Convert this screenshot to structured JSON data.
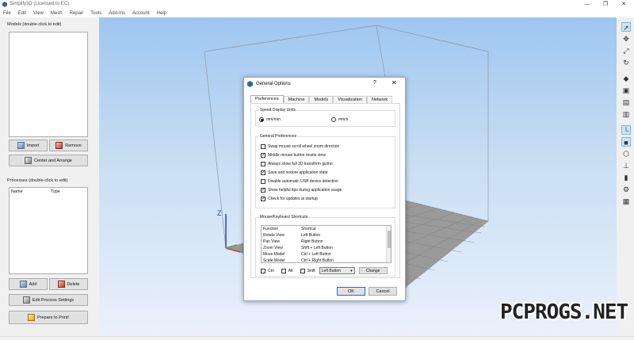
{
  "window": {
    "title": "Simplify3D (Licensed to EC)",
    "minimize": "—",
    "maximize": "❐",
    "close": "✕"
  },
  "menu": [
    "File",
    "Edit",
    "View",
    "Mesh",
    "Repair",
    "Tools",
    "Add-Ins",
    "Account",
    "Help"
  ],
  "models_panel": {
    "label": "Models (double-click to edit)",
    "import_label": "Import",
    "remove_label": "Remove",
    "center_label": "Center and Arrange"
  },
  "processes_panel": {
    "label": "Processes (double-click to edit)",
    "col_name": "Name",
    "col_type": "Type",
    "add_label": "Add",
    "delete_label": "Delete",
    "edit_label": "Edit Process Settings",
    "prepare_label": "Prepare to Print!"
  },
  "dialog": {
    "title": "General Options",
    "help": "?",
    "close": "✕",
    "tabs": [
      "Preferences",
      "Machine",
      "Models",
      "Visualization",
      "Network"
    ],
    "speed_units": {
      "label": "Speed Display Units",
      "options": [
        "mm/min",
        "mm/s"
      ],
      "selected": "mm/min"
    },
    "general_prefs": {
      "label": "General Preferences",
      "items": [
        {
          "label": "Swap mouse scroll wheel zoom direction",
          "checked": false
        },
        {
          "label": "Middle mouse button resets view",
          "checked": true
        },
        {
          "label": "Always show full 3D transform gizmo",
          "checked": false
        },
        {
          "label": "Save and restore application state",
          "checked": true
        },
        {
          "label": "Disable automatic USB device detection",
          "checked": false
        },
        {
          "label": "Show helpful tips during application usage",
          "checked": true
        },
        {
          "label": "Check for updates at startup",
          "checked": true
        }
      ]
    },
    "shortcuts": {
      "label": "Mouse/Keyboard Shortcuts",
      "headers": [
        "Function",
        "Shortcut"
      ],
      "rows": [
        [
          "Rotate View",
          "Left Button"
        ],
        [
          "Pan View",
          "Right Button"
        ],
        [
          "Zoom View",
          "Shift + Left Button"
        ],
        [
          "Move Model",
          "Ctrl + Left Button"
        ],
        [
          "Scale Model",
          "Ctrl + Right Button"
        ]
      ],
      "mod_ctrl": "Ctrl",
      "mod_alt": "Alt",
      "mod_shift": "Shift",
      "button_value": "Left Button",
      "change_label": "Change"
    },
    "ok_label": "OK",
    "cancel_label": "Cancel"
  },
  "watermark": "PCPROGS.NET",
  "colors": {
    "accent": "#0078d7",
    "axis_x": "#e03030",
    "axis_y": "#2db34a",
    "axis_z": "#2c3de0"
  }
}
